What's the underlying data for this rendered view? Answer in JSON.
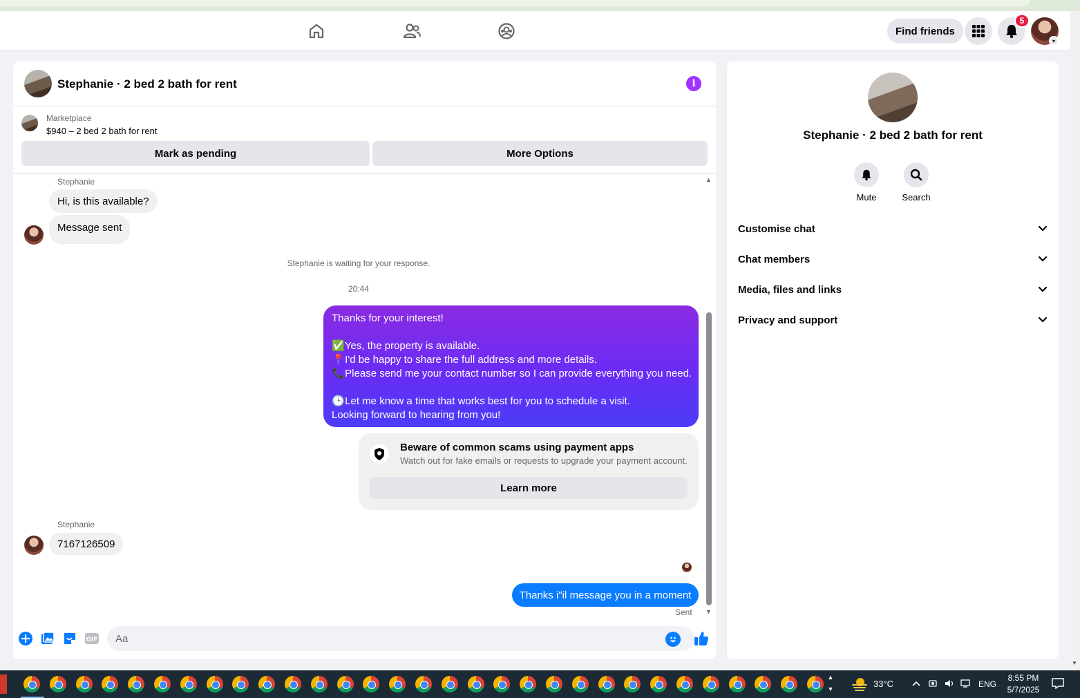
{
  "nav": {
    "find_friends": "Find friends",
    "notification_count": "5",
    "icons": [
      "home-icon",
      "friends-icon",
      "groups-icon",
      "menu-grid-icon",
      "bell-icon"
    ]
  },
  "chat": {
    "title": "Stephanie · 2 bed 2 bath for rent",
    "marketplace_label": "Marketplace",
    "listing": "$940 – 2 bed 2 bath for rent",
    "mark_pending": "Mark as pending",
    "more_options": "More Options",
    "messages": {
      "sender1": "Stephanie",
      "msg1": "Hi, is this available?",
      "msg2": "Message sent",
      "waiting": "Stephanie is waiting for your response.",
      "time": "20:44",
      "out_lines": [
        "Thanks for your interest!",
        "Yes, the property is available.",
        "I'd be happy to share the full address and more details.",
        "Please send me your contact number so I can provide everything you need.",
        "Let me know a time that works best for you to schedule a visit.",
        "Looking forward to hearing from you!"
      ],
      "out_emojis": [
        "✅",
        "📍",
        "📞",
        "🕒"
      ],
      "scam_title": "Beware of common scams using payment apps",
      "scam_desc": "Watch out for fake emails or requests to upgrade your payment account.",
      "learn_more": "Learn more",
      "sender2": "Stephanie",
      "msg3": "7167126509",
      "reply": "Thanks i\"il message you in a moment",
      "status": "Sent"
    },
    "composer_placeholder": "Aa"
  },
  "info": {
    "title": "Stephanie · 2 bed 2 bath for rent",
    "mute": "Mute",
    "search": "Search",
    "rows": [
      "Customise chat",
      "Chat members",
      "Media, files and links",
      "Privacy and support"
    ]
  },
  "taskbar": {
    "temperature": "33°C",
    "language": "ENG",
    "time": "8:55 PM",
    "date": "5/7/2025"
  },
  "colors": {
    "accent": "#0a7cff",
    "purple_top": "#8a2be2",
    "purple_bottom": "#4b3cf7",
    "badge": "#e41e3f"
  }
}
